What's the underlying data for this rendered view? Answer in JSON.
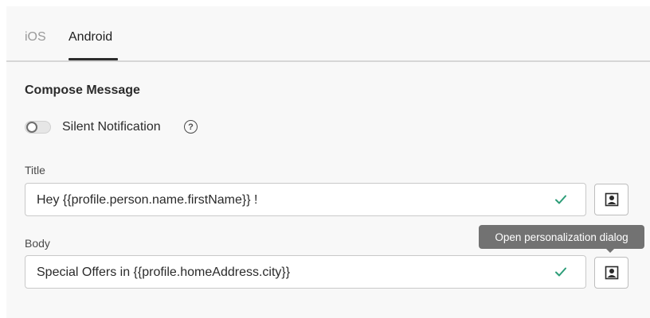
{
  "tabs": [
    {
      "label": "iOS",
      "selected": false
    },
    {
      "label": "Android",
      "selected": true
    }
  ],
  "section": {
    "title": "Compose Message"
  },
  "silent_notification": {
    "label": "Silent Notification",
    "enabled": false,
    "help_icon": "?"
  },
  "fields": {
    "title": {
      "label": "Title",
      "value": "Hey {{profile.person.name.firstName}} !",
      "status_icon": "check-icon",
      "button_icon": "personalization-icon"
    },
    "body": {
      "label": "Body",
      "value": "Special Offers in {{profile.homeAddress.city}}",
      "status_icon": "check-icon",
      "button_icon": "personalization-icon"
    }
  },
  "tooltip": {
    "text": "Open personalization dialog"
  },
  "colors": {
    "check": "#2d9d78",
    "tooltip_bg": "#727272"
  }
}
